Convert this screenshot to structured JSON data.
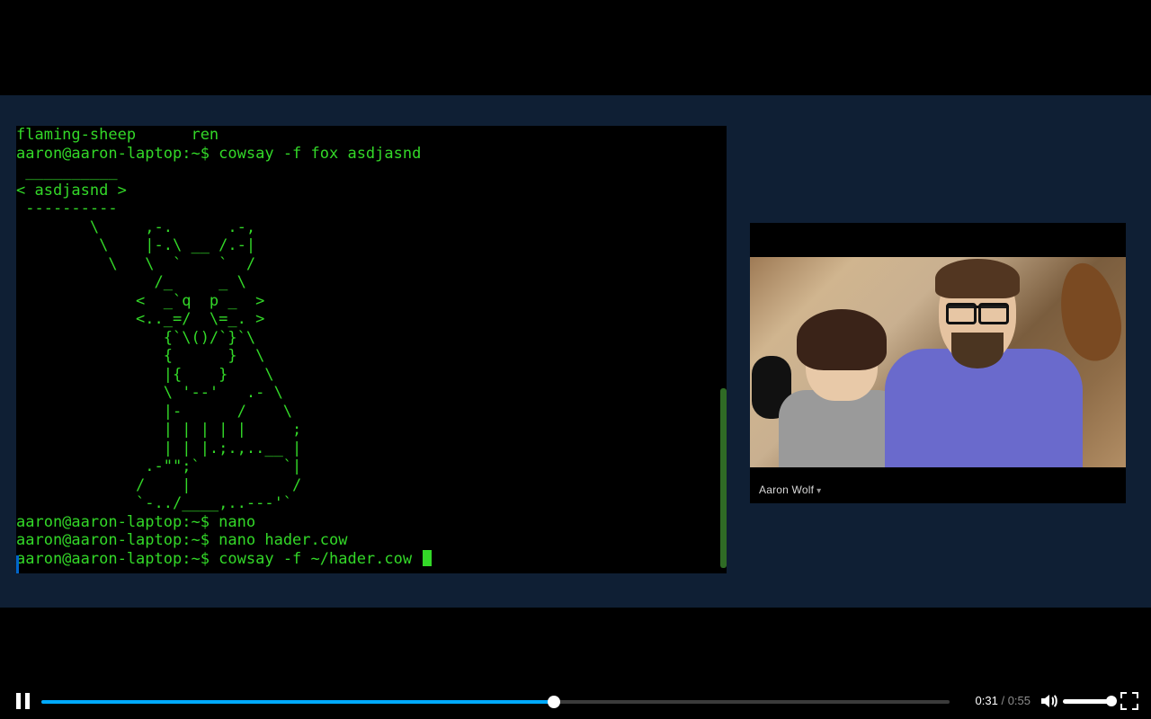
{
  "terminal": {
    "line0": "flaming-sheep      ren",
    "prompt": "aaron@aaron-laptop:~$ ",
    "cmd1": "cowsay -f fox asdjasnd",
    "bubble_top": " __________",
    "bubble_mid": "< asdjasnd >",
    "bubble_bot": " ----------",
    "art01": "        \\     ,-.      .-,",
    "art02": "         \\    |-.\\ __ /.-|",
    "art03": "          \\   \\  `    `  /",
    "art04": "               /_     _ \\",
    "art05": "             <  _`q  p _  >",
    "art06": "             <.._=/  \\=_. >",
    "art07": "                {`\\()/`}`\\",
    "art08": "                {      }  \\",
    "art09": "                |{    }    \\",
    "art10": "                \\ '--'   .- \\",
    "art11": "                |-      /    \\",
    "art12": "                | | | | |     ;",
    "art13": "                | | |.;.,..__ |",
    "art14": "              .-\"\";`         `|",
    "art15": "             /    |           /",
    "art16": "             `-../____,..---'`",
    "cmd2": "nano",
    "cmd3": "nano hader.cow",
    "cmd4": "cowsay -f ~/hader.cow "
  },
  "webcam": {
    "caption_name": "Aaron Wolf"
  },
  "player": {
    "current_time": "0:31",
    "duration": "0:55",
    "progress_pct": 56.4,
    "volume_pct": 100
  }
}
